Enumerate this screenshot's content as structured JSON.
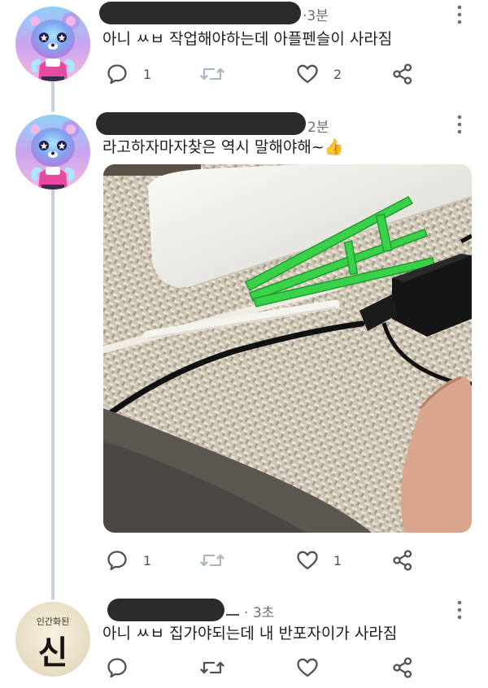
{
  "tweets": [
    {
      "time": "3분",
      "text": "아니 ㅆㅂ 작업해야하는데 아플펜슬이 사라짐",
      "replies": "1",
      "likes": "2"
    },
    {
      "time": "2분",
      "text": "라고하자마자찾은 역시 말해야해~",
      "emoji": "👍",
      "replies": "1",
      "likes": "1"
    },
    {
      "time": "3초",
      "text": "아니 ㅆㅂ 집가야되는데 내 반포자이가 사라짐",
      "avatar_text_top": "인간화된",
      "avatar_text_main": "신",
      "replies": "",
      "likes": ""
    }
  ],
  "icons": {
    "reply": "reply-icon",
    "retweet": "retweet-icon",
    "like": "heart-icon",
    "share": "share-icon",
    "more": "more-vertical-icon"
  },
  "colors": {
    "icon": "#4d5358",
    "thread_line": "#c9d1d8",
    "redaction": "#2b2b2b",
    "meta": "#6b7177"
  }
}
